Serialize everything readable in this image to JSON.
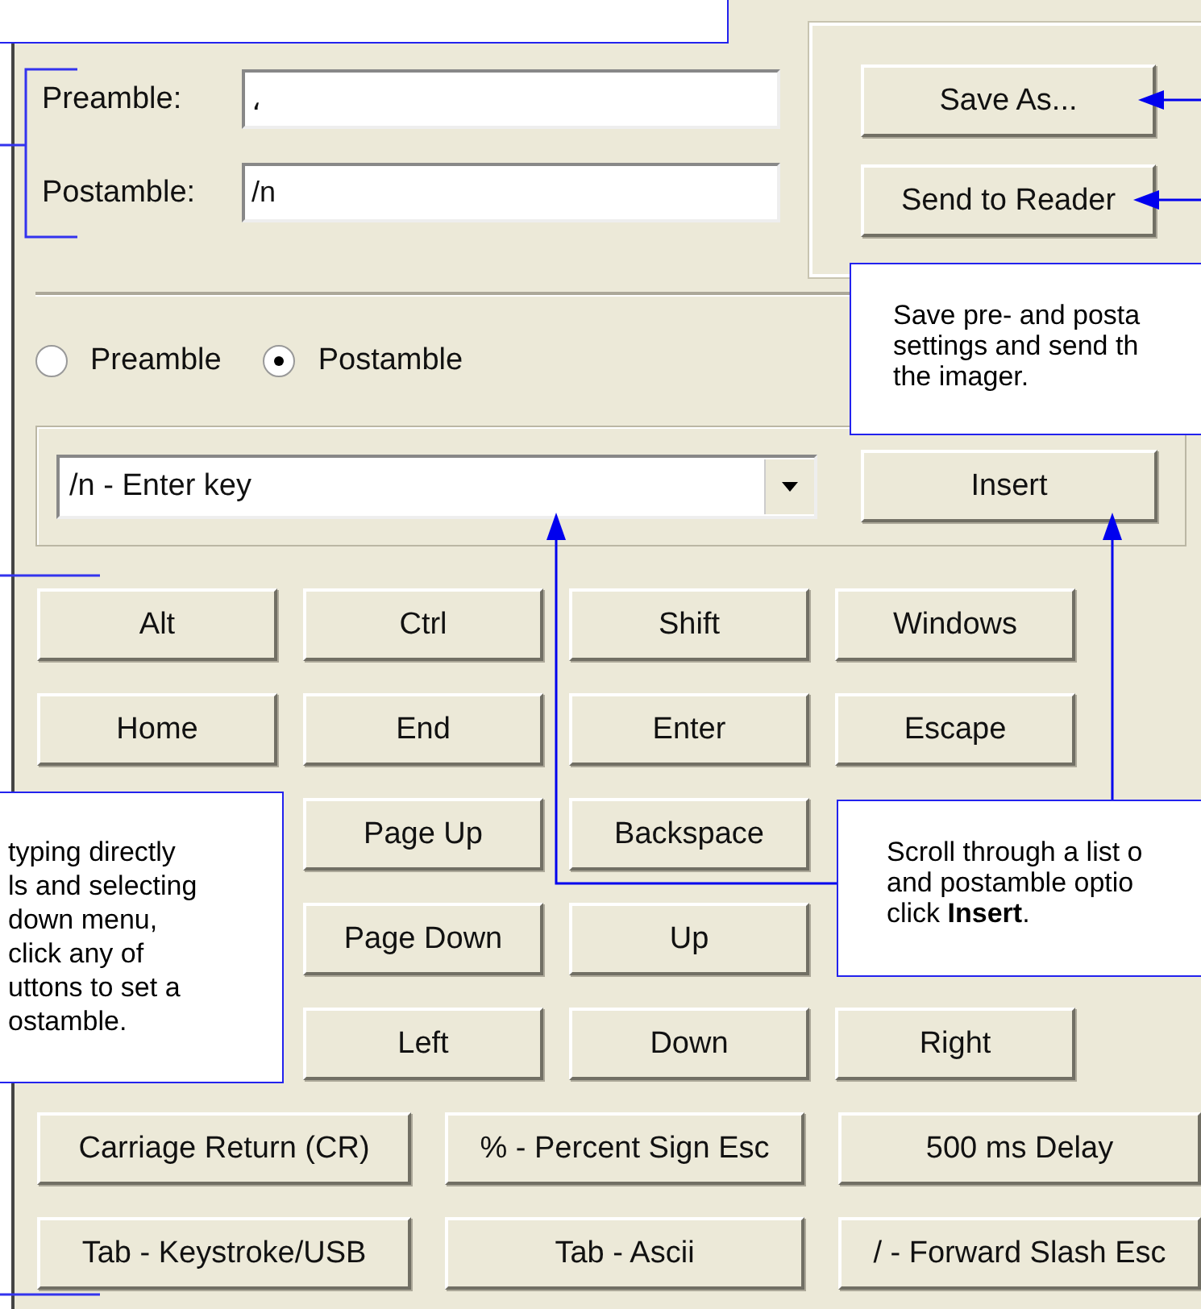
{
  "fields": [
    {
      "label": "Preamble:",
      "value": "،"
    },
    {
      "label": "Postamble:",
      "value": "/n"
    }
  ],
  "side_buttons": [
    "Save As...",
    "Send to Reader"
  ],
  "radios": [
    {
      "label": "Preamble",
      "selected": false
    },
    {
      "label": "Postamble",
      "selected": true
    }
  ],
  "dropdown": {
    "value": "/n - Enter key"
  },
  "insert_button": "Insert",
  "key_rows": [
    [
      "Alt",
      "Ctrl",
      "Shift",
      "Windows"
    ],
    [
      "Home",
      "End",
      "Enter",
      "Escape"
    ],
    [
      null,
      "Page Up",
      "Backspace",
      null
    ],
    [
      null,
      "Page Down",
      "Up",
      null
    ],
    [
      null,
      "Left",
      "Down",
      "Right"
    ]
  ],
  "wide_rows": [
    [
      "Carriage Return (CR)",
      "% - Percent Sign Esc",
      "500 ms Delay"
    ],
    [
      "Tab - Keystroke/USB",
      "Tab - Ascii",
      "/ - Forward Slash Esc"
    ]
  ],
  "callouts": [
    {
      "kind": "save",
      "lines": [
        "Save pre- and posta",
        "settings and send th",
        "the imager."
      ]
    },
    {
      "kind": "typing",
      "lines": [
        "typing directly",
        "ls and selecting",
        "down menu,",
        "click any of",
        "uttons to set a",
        "ostamble."
      ]
    },
    {
      "kind": "scroll",
      "lines": [
        "Scroll through a list o",
        "and postamble optio",
        "click **Insert**."
      ]
    }
  ]
}
